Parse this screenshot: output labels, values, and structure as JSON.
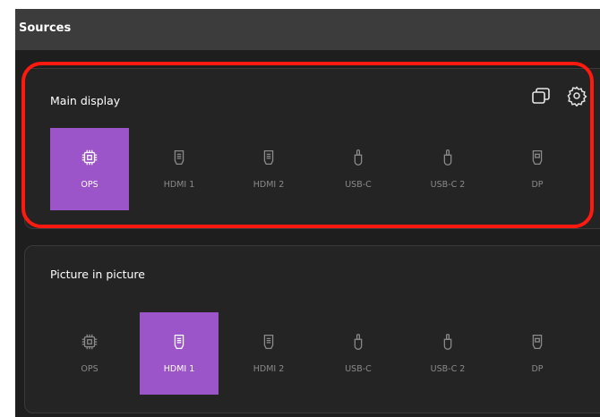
{
  "header": {
    "title": "Sources"
  },
  "main_display": {
    "title": "Main display",
    "actions": [
      {
        "icon": "windows-icon"
      },
      {
        "icon": "gear-icon"
      }
    ],
    "sources": [
      {
        "label": "OPS",
        "icon": "chip-icon",
        "selected": true
      },
      {
        "label": "HDMI 1",
        "icon": "hdmi-icon",
        "selected": false
      },
      {
        "label": "HDMI 2",
        "icon": "hdmi-icon",
        "selected": false
      },
      {
        "label": "USB-C",
        "icon": "usb-c-icon",
        "selected": false
      },
      {
        "label": "USB-C 2",
        "icon": "usb-c-icon",
        "selected": false
      },
      {
        "label": "DP",
        "icon": "displayport-icon",
        "selected": false
      }
    ]
  },
  "picture_in_picture": {
    "title": "Picture in picture",
    "sources": [
      {
        "label": "OPS",
        "icon": "chip-icon",
        "selected": false
      },
      {
        "label": "HDMI 1",
        "icon": "hdmi-icon",
        "selected": true
      },
      {
        "label": "HDMI 2",
        "icon": "hdmi-icon",
        "selected": false
      },
      {
        "label": "USB-C",
        "icon": "usb-c-icon",
        "selected": false
      },
      {
        "label": "USB-C 2",
        "icon": "usb-c-icon",
        "selected": false
      },
      {
        "label": "DP",
        "icon": "displayport-icon",
        "selected": false
      }
    ]
  },
  "colors": {
    "accent": "#9c55c9",
    "highlight": "#ff1a0f",
    "background": "#1e1e1e",
    "header": "#3c3c3c"
  }
}
